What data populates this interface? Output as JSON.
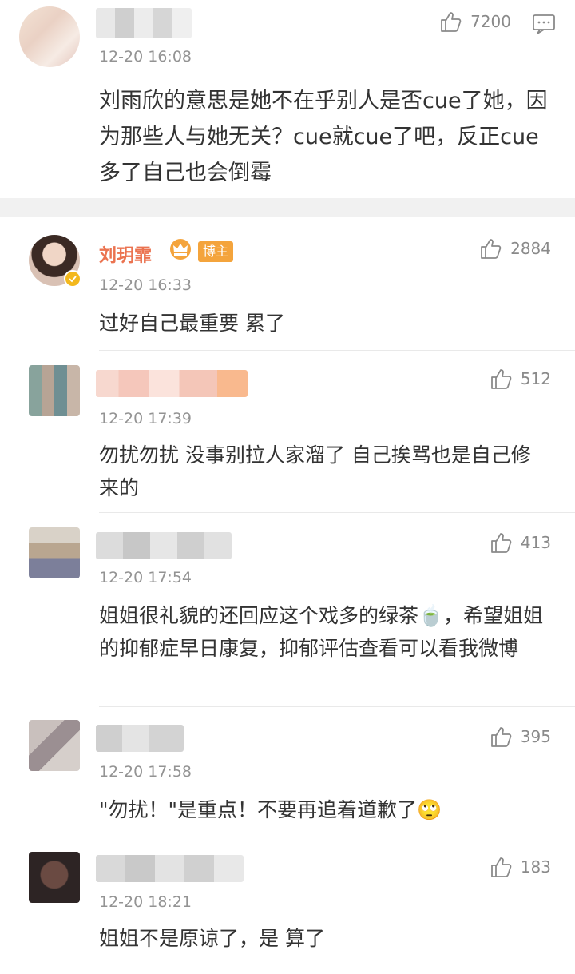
{
  "main_comment": {
    "time": "12-20 16:08",
    "likes": "7200",
    "text": "刘雨欣的意思是她不在乎别人是否cue了她，因为那些人与她无关？cue就cue了吧，反正cue多了自己也会倒霉"
  },
  "replies": [
    {
      "name": "刘玥霏",
      "badge": "博主",
      "time": "12-20 16:33",
      "likes": "2884",
      "text": "过好自己最重要 累了"
    },
    {
      "time": "12-20 17:39",
      "likes": "512",
      "text": "勿扰勿扰 没事别拉人家溜了 自己挨骂也是自己修来的"
    },
    {
      "time": "12-20 17:54",
      "likes": "413",
      "text": "姐姐很礼貌的还回应这个戏多的绿茶🍵，希望姐姐的抑郁症早日康复，抑郁评估查看可以看我微博"
    },
    {
      "time": "12-20 17:58",
      "likes": "395",
      "text": "\"勿扰！\"是重点！不要再追着道歉了🙄"
    },
    {
      "time": "12-20 18:21",
      "likes": "183",
      "text": "姐姐不是原谅了，是 算了"
    }
  ],
  "icons": {
    "like": "thumbs-up-icon",
    "reply": "comment-icon",
    "crown": "crown-icon",
    "verified": "verified-badge-icon"
  },
  "colors": {
    "name_orange": "#eb7350",
    "badge_orange": "#f4a43c",
    "verified_yellow": "#f3b81d"
  }
}
